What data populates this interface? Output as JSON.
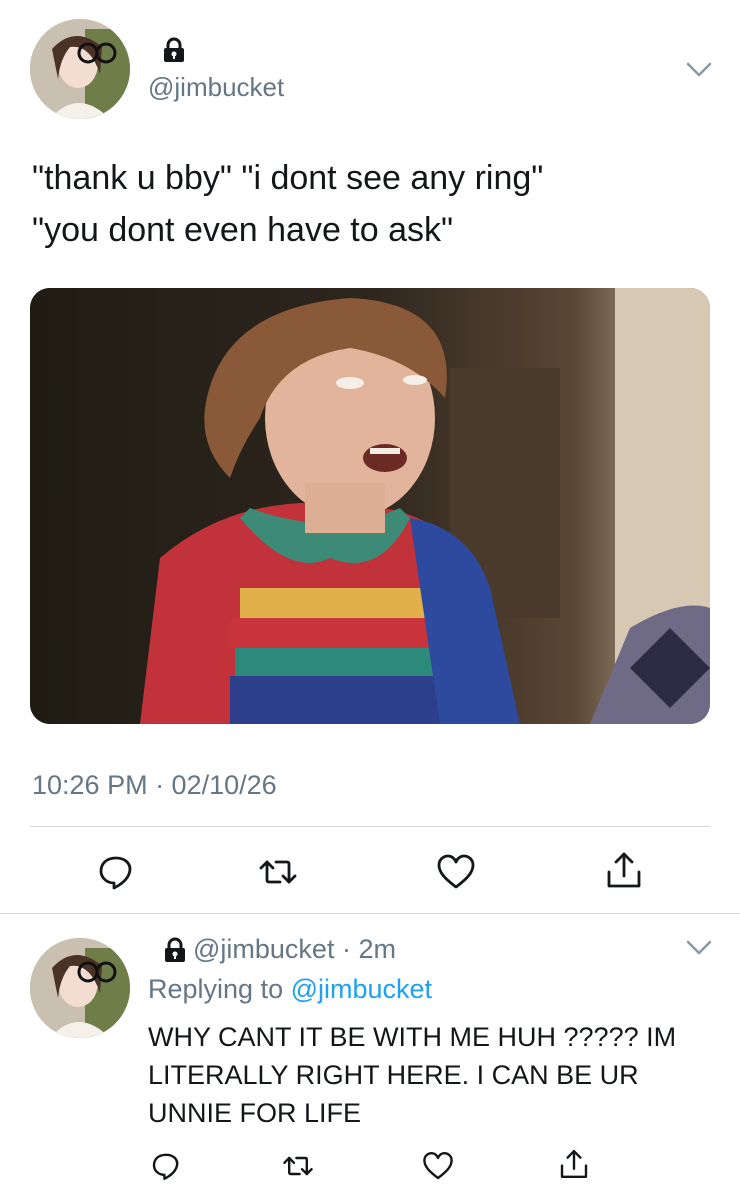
{
  "tweet": {
    "handle": "@jimbucket",
    "text_line1": "\"thank u bby\" \"i dont see any ring\"",
    "text_line2": "\"you dont even have to ask\"",
    "timestamp": "10:26 PM · 02/10/26",
    "icons": {
      "lock": "lock-icon",
      "more": "chevron-down-icon",
      "reply": "reply-icon",
      "retweet": "retweet-icon",
      "like": "heart-icon",
      "share": "share-icon"
    }
  },
  "reply": {
    "handle": "@jimbucket · 2m",
    "replying_prefix": "Replying to",
    "replying_mention": "@jimbucket",
    "text": "WHY CANT IT BE WITH ME HUH ????? IM LITERALLY RIGHT HERE. I CAN BE UR UNNIE FOR LIFE"
  },
  "colors": {
    "text": "#14171a",
    "secondary": "#657786",
    "accent": "#1da1f2",
    "divider": "#d4d9dd"
  }
}
